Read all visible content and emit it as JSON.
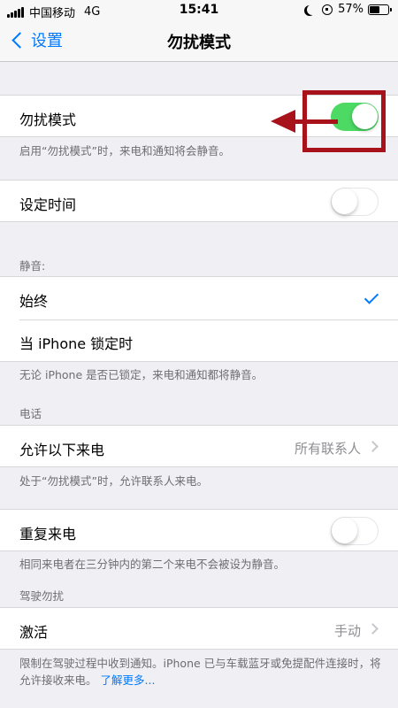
{
  "status_bar": {
    "carrier": "中国移动",
    "network": "4G",
    "time": "15:41",
    "battery": "57%",
    "battery_level": 0.57
  },
  "nav": {
    "back_label": "设置",
    "title": "勿扰模式"
  },
  "dnd": {
    "label": "勿扰模式",
    "enabled": true,
    "footer": "启用“勿扰模式”时，来电和通知将会静音。"
  },
  "scheduled": {
    "label": "设定时间",
    "enabled": false
  },
  "silence": {
    "header": "静音:",
    "always_label": "始终",
    "locked_label": "当 iPhone 锁定时",
    "footer": "无论 iPhone 是否已锁定，来电和通知都将静音。"
  },
  "phone": {
    "header": "电话",
    "allow_calls_label": "允许以下来电",
    "allow_calls_value": "所有联系人",
    "footer": "处于“勿扰模式”时，允许联系人来电。",
    "repeated_calls_label": "重复来电",
    "repeated_calls_enabled": false,
    "repeated_footer": "相同来电者在三分钟内的第二个来电不会被设为静音。"
  },
  "driving": {
    "header": "驾驶勿扰",
    "activate_label": "激活",
    "activate_value": "手动",
    "footer": "限制在驾驶过程中收到通知。iPhone 已与车载蓝牙或免提配件连接时，将允许接收来电。",
    "learn_more": "了解更多..."
  },
  "colors": {
    "accent": "#007aff",
    "switch_on": "#4cd964",
    "annotation": "#a8121b"
  }
}
